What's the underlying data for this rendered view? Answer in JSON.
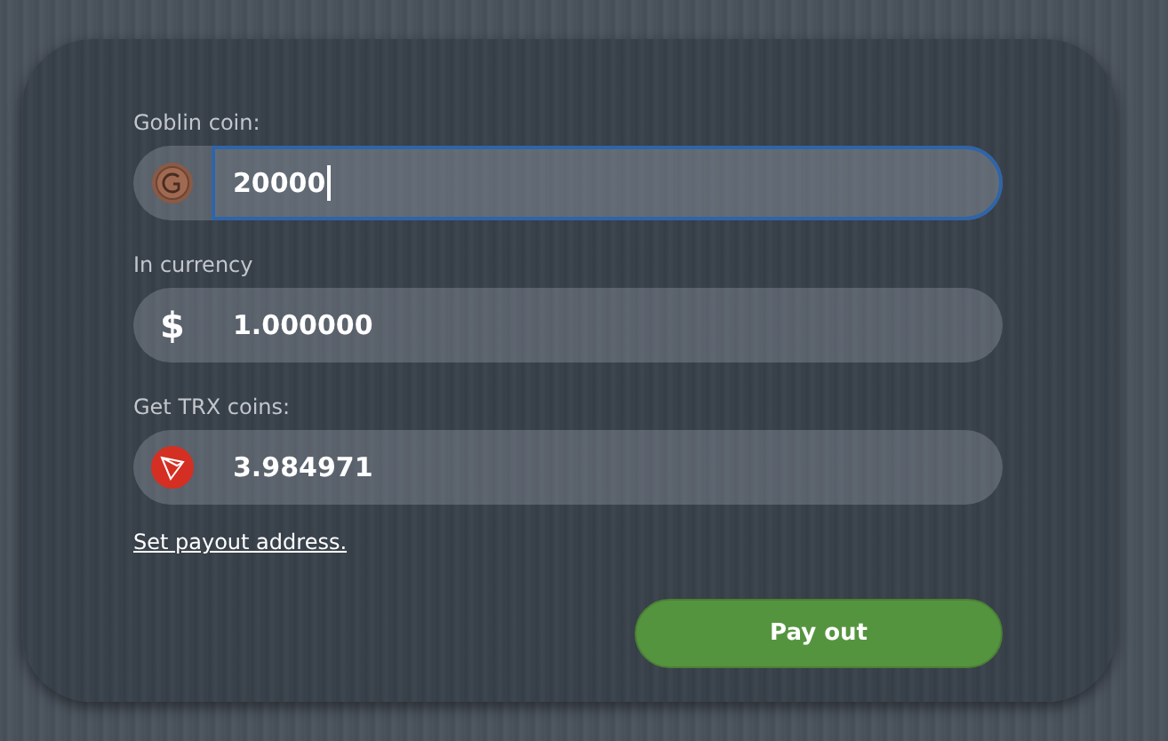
{
  "fields": [
    {
      "label": "Goblin coin:",
      "kind": "coin",
      "value": "20000",
      "focused": true
    },
    {
      "label": "In currency",
      "kind": "symbol",
      "symbol": "$",
      "value": "1.000000",
      "focused": false
    },
    {
      "label": "Get TRX coins:",
      "kind": "trx",
      "value": "3.984971",
      "focused": false
    }
  ],
  "link": "Set payout address.",
  "button": "Pay out"
}
